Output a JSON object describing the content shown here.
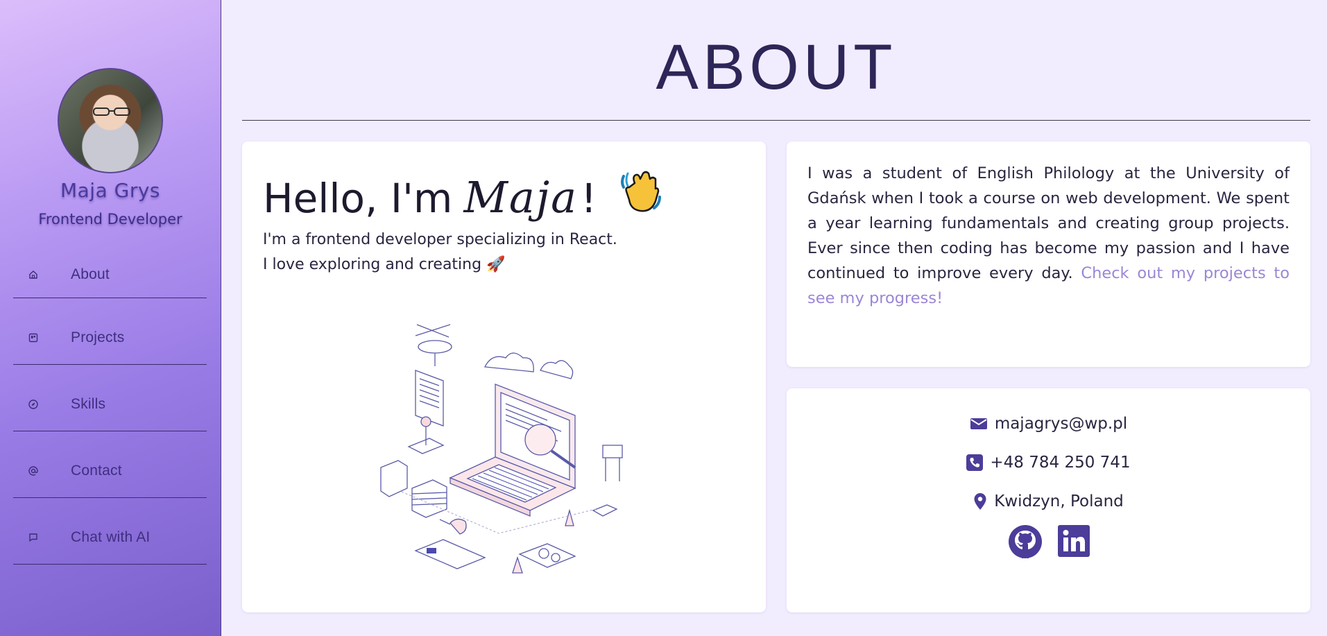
{
  "profile": {
    "name": "Maja Grys",
    "role": "Frontend Developer"
  },
  "nav": {
    "items": [
      {
        "label": "About",
        "icon": "home-icon"
      },
      {
        "label": "Projects",
        "icon": "projects-icon"
      },
      {
        "label": "Skills",
        "icon": "compass-icon"
      },
      {
        "label": "Contact",
        "icon": "at-icon"
      },
      {
        "label": "Chat with AI",
        "icon": "chat-icon"
      }
    ]
  },
  "page": {
    "title": "ABOUT"
  },
  "hello": {
    "greeting": "Hello, I'm",
    "name": "Maja",
    "exclaim": "!",
    "line1": "I'm a frontend developer specializing in React.",
    "line2": "I love exploring and creating",
    "rocket": "🚀"
  },
  "bio": {
    "text": "I was a student of English Philology at the University of Gdańsk when I took a course on web development. We spent a year learning fundamentals and creating group projects. Ever since then coding has become my passion and I have continued to improve every day. ",
    "link": "Check out my projects to see my progress!"
  },
  "contact": {
    "email": "majagrys@wp.pl",
    "phone": "+48 784 250 741",
    "location": "Kwidzyn, Poland",
    "socials": [
      "github-icon",
      "linkedin-icon"
    ]
  },
  "colors": {
    "accent": "#4b3d99",
    "link": "#9b86d6",
    "background": "#f2ecff"
  }
}
